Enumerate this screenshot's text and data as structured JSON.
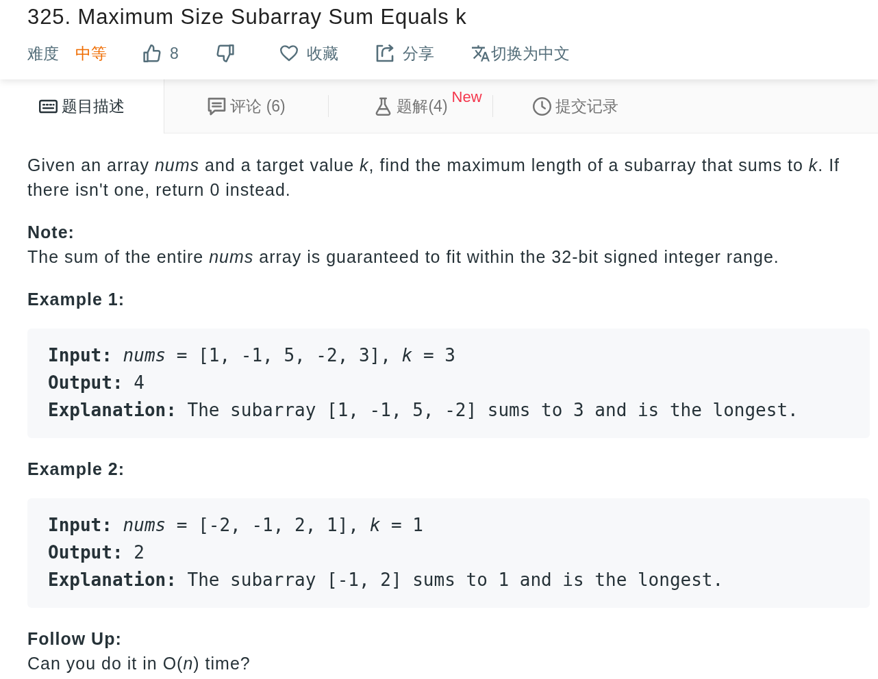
{
  "problem": {
    "title": "325. Maximum Size Subarray Sum Equals k"
  },
  "meta": {
    "difficulty_label": "难度",
    "difficulty": "中等",
    "likes": "8",
    "favorite": "收藏",
    "share": "分享",
    "translate": "切换为中文"
  },
  "tabs": [
    {
      "label": "题目描述",
      "selected": true
    },
    {
      "label": "评论 (6)",
      "selected": false
    },
    {
      "label": "题解(4)",
      "selected": false,
      "badge": "New"
    },
    {
      "label": "提交记录",
      "selected": false
    }
  ],
  "description": "Given an array *nums* and a target value *k*, find the maximum length of a subarray that sums to *k*. If there isn't one, return 0 instead.",
  "note": {
    "heading": "Note:",
    "text": "The sum of the entire *nums* array is guaranteed to fit within the 32-bit signed integer range."
  },
  "examples": [
    {
      "heading": "Example 1:",
      "lines": [
        "**Input:** *nums* = [1, -1, 5, -2, 3], *k* = 3",
        "**Output:** 4",
        "**Explanation:** The subarray [1, -1, 5, -2] sums to 3 and is the longest."
      ]
    },
    {
      "heading": "Example 2:",
      "lines": [
        "**Input:** *nums* = [-2, -1, 2, 1], *k* = 1",
        "**Output:** 2",
        "**Explanation:** The subarray [-1, 2] sums to 1 and is the longest."
      ]
    }
  ],
  "follow_up": {
    "heading": "Follow Up:",
    "text": "Can you do it in O(*n*) time?"
  }
}
